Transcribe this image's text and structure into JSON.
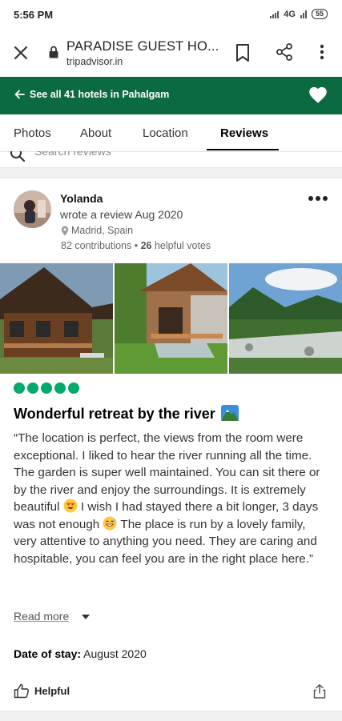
{
  "status_bar": {
    "time": "5:56 PM",
    "network": "4G",
    "battery": "55"
  },
  "browser": {
    "title": "PARADISE GUEST HO...",
    "url": "tripadvisor.in"
  },
  "banner": {
    "see_all": "See all 41 hotels in Pahalgam"
  },
  "tabs": [
    {
      "label": "Photos"
    },
    {
      "label": "About"
    },
    {
      "label": "Location"
    },
    {
      "label": "Reviews"
    }
  ],
  "search": {
    "placeholder": "Search reviews"
  },
  "review": {
    "author": "Yolanda",
    "wrote": "wrote a review Aug 2020",
    "location": "Madrid, Spain",
    "contributions": "82 contributions",
    "helpful_votes_count": "26",
    "helpful_votes_label": "helpful votes",
    "rating": 5,
    "title": "Wonderful retreat by the river",
    "body_part1": "“The location is perfect, the views from the room were exceptional. I liked to hear the river running all the time. The garden is super well maintained. You can sit there or by the river and enjoy the surroundings. It is extremely beautiful",
    "body_part2": " I wish I had stayed there a bit longer, 3 days was not enough",
    "body_part3": " The place is run by a lovely family, very attentive to anything you need. They are caring and hospitable, you can feel you are in the right place here.”",
    "read_more": "Read more",
    "date_of_stay_label": "Date of stay:",
    "date_of_stay_value": "August 2020",
    "helpful_button": "Helpful"
  },
  "colors": {
    "brand_green": "#0b6a3f",
    "bubble_green": "#00aa6c"
  }
}
